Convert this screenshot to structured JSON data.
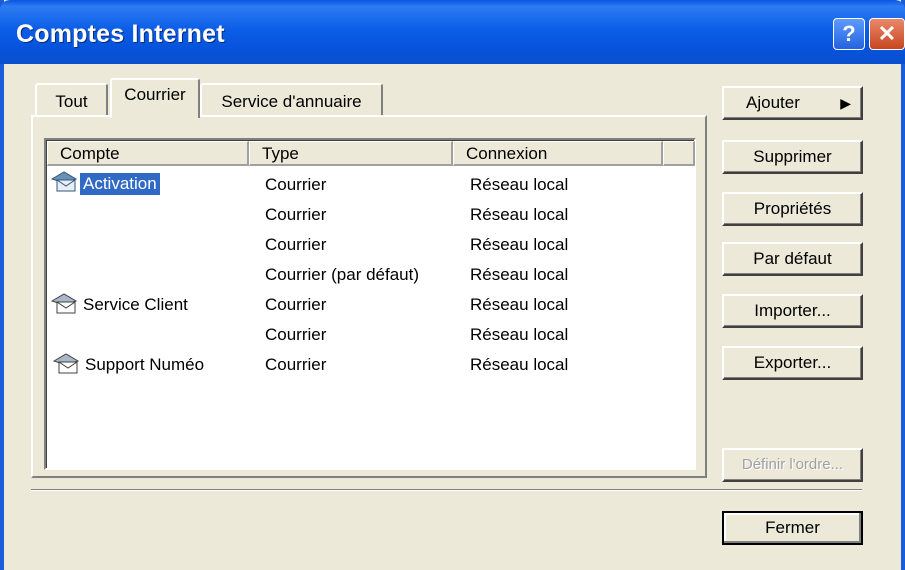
{
  "window": {
    "title": "Comptes Internet"
  },
  "titlebar": {
    "help_glyph": "?",
    "close_glyph": "✕"
  },
  "tabs": [
    {
      "label": "Tout",
      "active": false
    },
    {
      "label": "Courrier",
      "active": true
    },
    {
      "label": "Service d'annuaire",
      "active": false
    }
  ],
  "list": {
    "columns": [
      "Compte",
      "Type",
      "Connexion"
    ],
    "rows": [
      {
        "account": "Activation",
        "type": "Courrier",
        "connection": "Réseau local",
        "icon": "mail-account-icon",
        "selected": true
      },
      {
        "account": "",
        "type": "Courrier",
        "connection": "Réseau local"
      },
      {
        "account": "",
        "type": "Courrier",
        "connection": "Réseau local"
      },
      {
        "account": "",
        "type": "Courrier (par défaut)",
        "connection": "Réseau local"
      },
      {
        "account": "Service Client",
        "type": "Courrier",
        "connection": "Réseau local",
        "icon": "mail-account-icon"
      },
      {
        "account": "",
        "type": "Courrier",
        "connection": "Réseau local"
      },
      {
        "account": "Support Numéo",
        "type": "Courrier",
        "connection": "Réseau local",
        "icon": "mail-account-icon"
      }
    ]
  },
  "buttons": {
    "add": "Ajouter",
    "add_arrow": "▶",
    "remove": "Supprimer",
    "properties": "Propriétés",
    "default": "Par défaut",
    "import": "Importer...",
    "export": "Exporter...",
    "set_order": "Définir l'ordre...",
    "close": "Fermer"
  },
  "colors": {
    "titlebar": "#0c5ee6",
    "selection": "#316ac5",
    "dialog_bg": "#ece9d8"
  }
}
